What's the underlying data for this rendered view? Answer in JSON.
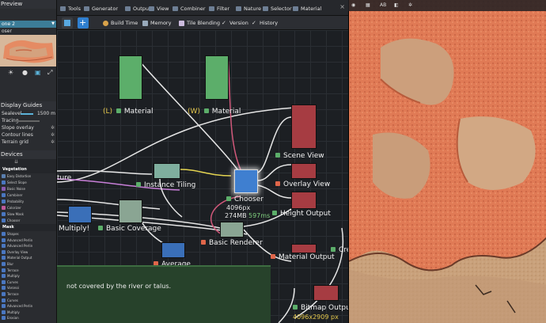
{
  "left_panel": {
    "preview_title": "Preview",
    "zone_value": "one 2",
    "chooser_value": "oser",
    "display_guides_title": "Display Guides",
    "sealevel_label": "Sealevel",
    "sealevel_value": "1500 m",
    "tracing_label": "Tracing",
    "slope_overlay_label": "Slope overlay",
    "contour_lines_label": "Contour lines",
    "terrain_grid_label": "Terrain grid",
    "devices_title": "Devices",
    "vegetation_label": "Vegetation",
    "devices": [
      {
        "label": "Easy Distortion",
        "color": "#5a7fb0"
      },
      {
        "label": "Select Slope",
        "color": "#4a77c0"
      },
      {
        "label": "Basic Noise",
        "color": "#8a5ab0"
      },
      {
        "label": "Combiner",
        "color": "#4a77c0"
      },
      {
        "label": "Probability",
        "color": "#4a77c0"
      },
      {
        "label": "Colorizer",
        "color": "#c05a9a"
      },
      {
        "label": "Slow Mask",
        "color": "#4a77c0"
      },
      {
        "label": "Chooser",
        "color": "#4a77c0"
      }
    ],
    "mask_label": "Mask",
    "mask_items": [
      "Shapes",
      "Advanced Perlin",
      "Advanced Perlin",
      "Overlay View",
      "Material Output",
      "Blur",
      "Terrace",
      "Multiply",
      "Curves",
      "Voronoi",
      "Terrace",
      "Curves",
      "Advanced Perlin",
      "Multiply",
      "Erosion"
    ]
  },
  "tabs": [
    {
      "label": "Tools"
    },
    {
      "label": "Generator"
    },
    {
      "label": "Output"
    },
    {
      "label": "View"
    },
    {
      "label": "Combiner"
    },
    {
      "label": "Filter"
    },
    {
      "label": "Nature"
    },
    {
      "label": "Selector"
    },
    {
      "label": "Material"
    }
  ],
  "toolbar": {
    "build_time": "Build Time",
    "memory": "Memory",
    "tile_blending": "Tile Blending",
    "version": "Version",
    "history": "History"
  },
  "graph": {
    "material_l_prefix": "(L)",
    "material_l_label": "Material",
    "material_w_prefix": "(W)",
    "material_w_label": "Material",
    "scene_view_label": "Scene View",
    "overlay_view_label": "Overlay View",
    "ture_label": "ture",
    "instance_tiling_label": "Instance Tiling",
    "chooser_label": "Chooser",
    "chooser_resolution": "4096px",
    "chooser_memory": "274MB",
    "chooser_time": "597ms",
    "height_output_label": "Height Output",
    "multiply_label": "Multiply!",
    "basic_coverage_label": "Basic Coverage",
    "basic_renderer_label": "Basic Renderer",
    "material_output_label": "Material Output",
    "cre_label": "Cre",
    "average_label": "Average",
    "comment_text": "not covered by the river or talus.",
    "bitmap_output_label": "Bitmap Outpu",
    "bitmap_resolution": "4096x2909 px"
  },
  "viewport": {
    "toolbar_icons": [
      "eye-icon",
      "grid-icon",
      "ab-icon",
      "layers-icon",
      "settings-icon"
    ],
    "ab_label": "AB"
  },
  "colors": {
    "generator_green": "#5cae6a",
    "output_red": "#a63c42",
    "tiling_teal": "#7fae9e",
    "chooser_blue": "#3f7fd0",
    "combiner_blue": "#3a6fb8",
    "renderer_gray": "#8aa593",
    "terrain_orange": "#e07a55",
    "terrain_sand": "#c9a17b"
  }
}
